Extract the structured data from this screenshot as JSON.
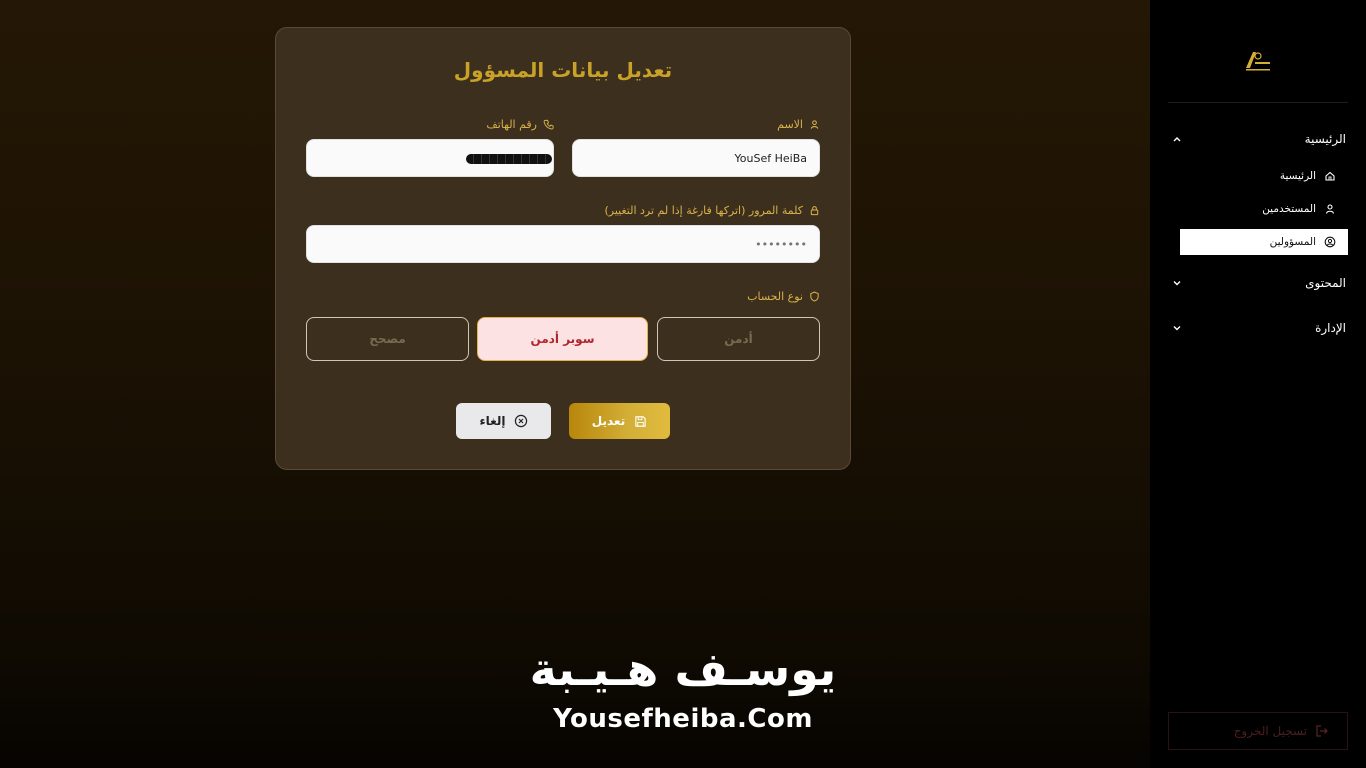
{
  "form": {
    "title": "تعديل بيانات المسؤول",
    "name_label": "الاسم",
    "name_value": "YouSef HeiBa",
    "phone_label": "رقم الهاتف",
    "phone_value": "",
    "password_label": "كلمة المرور (اتركها فارغة إذا لم ترد التغيير)",
    "password_placeholder": "••••••••",
    "account_type_label": "نوع الحساب",
    "account_types": [
      "أدمن",
      "سوبر أدمن",
      "مصحح"
    ],
    "selected_account_type": "سوبر أدمن",
    "submit_label": "تعديل",
    "cancel_label": "إلغاء"
  },
  "sidebar": {
    "groups": [
      {
        "label": "الرئيسية",
        "expanded": true,
        "items": [
          {
            "label": "الرئيسية",
            "icon": "home-icon"
          },
          {
            "label": "المستخدمين",
            "icon": "user-icon"
          },
          {
            "label": "المسؤولين",
            "icon": "user-circle-icon",
            "active": true
          }
        ]
      },
      {
        "label": "المحتوى",
        "expanded": false
      },
      {
        "label": "الإدارة",
        "expanded": false
      }
    ],
    "logout_label": "تسجيل الخروج"
  },
  "watermark": {
    "arabic": "يوسـف هـيـبة",
    "english": "Yousefheiba.Com"
  },
  "colors": {
    "accent": "#c9a227",
    "card_bg": "#3d2f1e",
    "selected_bg": "#fde2e4",
    "selected_text": "#b0262d",
    "sidebar_bg": "#000000"
  }
}
